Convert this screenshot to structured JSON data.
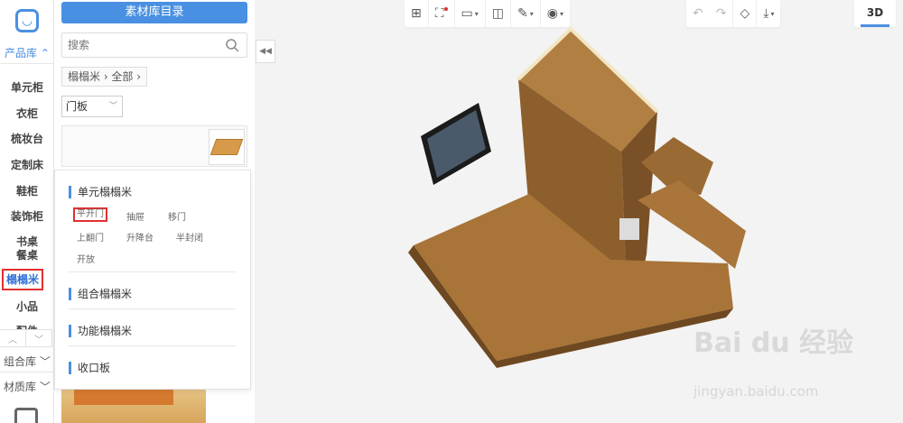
{
  "rail": {
    "product_lib": "产品库",
    "items": [
      "单元柜",
      "衣柜",
      "梳妆台",
      "定制床",
      "鞋柜",
      "装饰柜",
      "书桌",
      "餐桌",
      "榻榻米",
      "小品",
      "配件"
    ],
    "group_lib": "组合库",
    "material_lib": "材质库"
  },
  "panel": {
    "library_button": "素材库目录",
    "search_placeholder": "搜索",
    "breadcrumb": "榻榻米 › 全部 ›",
    "door_select": "门板"
  },
  "popup": {
    "sections": [
      {
        "title": "单元榻榻米",
        "options": [
          "平开门",
          "抽屉",
          "移门",
          "上翻门",
          "升降台",
          "半封闭",
          "开放"
        ]
      },
      {
        "title": "组合榻榻米"
      },
      {
        "title": "功能榻榻米"
      },
      {
        "title": "收口板"
      }
    ]
  },
  "toolbar": {
    "view_3d": "3D"
  },
  "watermark": {
    "brand": "Bai du 经验",
    "url": "jingyan.baidu.com"
  },
  "colors": {
    "accent": "#4a90e2",
    "highlight": "#e03030"
  }
}
